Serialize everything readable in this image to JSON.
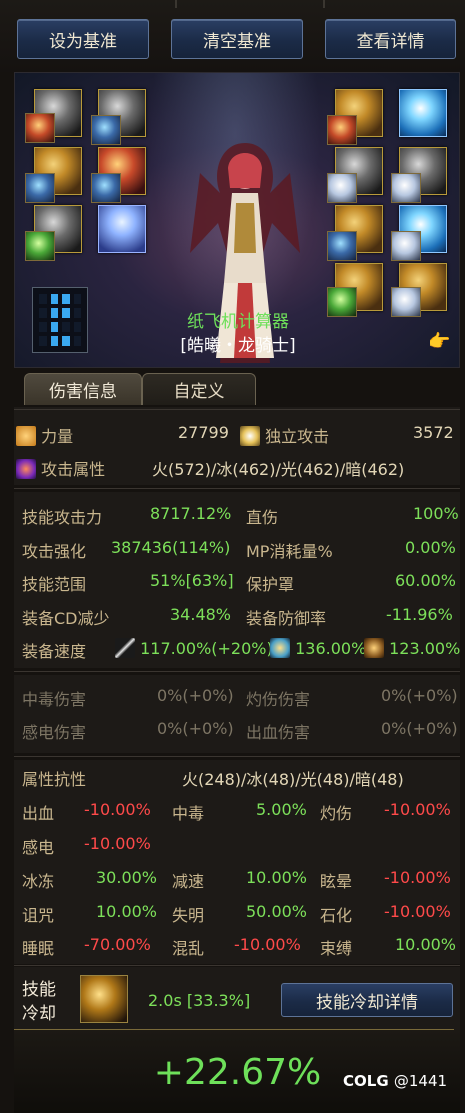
{
  "top_buttons": [
    {
      "label": "设为基准"
    },
    {
      "label": "清空基准"
    },
    {
      "label": "查看详情"
    }
  ],
  "avatar": {
    "calculator_name": "纸飞机计算器",
    "character_title": "[皓曦・龙骑士]",
    "hand_icon": "pointing-hand-icon"
  },
  "tabs": [
    {
      "label": "伤害信息",
      "active": true
    },
    {
      "label": "自定义",
      "active": false
    }
  ],
  "main_stats": {
    "strength_label": "力量",
    "strength_value": "27799",
    "independent_attack_label": "独立攻击",
    "independent_attack_value": "3572",
    "element_label": "攻击属性",
    "element_value": "火(572)/冰(462)/光(462)/暗(462)"
  },
  "skill_stats": {
    "skill_attack_label": "技能攻击力",
    "skill_attack_value": "8717.12%",
    "direct_label": "直伤",
    "direct_value": "100%",
    "attack_enhance_label": "攻击强化",
    "attack_enhance_value": "387436(114%)",
    "mp_cost_label": "MP消耗量%",
    "mp_cost_value": "0.00%",
    "skill_range_label": "技能范围",
    "skill_range_value": "51%[63%]",
    "shield_label": "保护罩",
    "shield_value": "60.00%",
    "cd_reduce_label": "装备CD减少",
    "cd_reduce_value": "34.48%",
    "equip_defense_label": "装备防御率",
    "equip_defense_value": "-11.96%",
    "equip_speed_label": "装备速度",
    "speed_attack_value": "117.00%(+20%)",
    "speed_cast_value": "136.00%",
    "speed_move_value": "123.00%"
  },
  "status_damage": {
    "poison_label": "中毒伤害",
    "poison_value": "0%(+0%)",
    "burn_label": "灼伤伤害",
    "burn_value": "0%(+0%)",
    "shock_label": "感电伤害",
    "shock_value": "0%(+0%)",
    "bleed_label": "出血伤害",
    "bleed_value": "0%(+0%)"
  },
  "resist": {
    "title_label": "属性抗性",
    "title_value": "火(248)/冰(48)/光(48)/暗(48)",
    "items": [
      {
        "label": "出血",
        "value": "-10.00%",
        "neg": true
      },
      {
        "label": "中毒",
        "value": "5.00%",
        "neg": false
      },
      {
        "label": "灼伤",
        "value": "-10.00%",
        "neg": true
      },
      {
        "label": "感电",
        "value": "-10.00%",
        "neg": true
      },
      {
        "label": "冰冻",
        "value": "30.00%",
        "neg": false
      },
      {
        "label": "减速",
        "value": "10.00%",
        "neg": false
      },
      {
        "label": "眩晕",
        "value": "-10.00%",
        "neg": true
      },
      {
        "label": "诅咒",
        "value": "10.00%",
        "neg": false
      },
      {
        "label": "失明",
        "value": "50.00%",
        "neg": false
      },
      {
        "label": "石化",
        "value": "-10.00%",
        "neg": true
      },
      {
        "label": "睡眠",
        "value": "-70.00%",
        "neg": true
      },
      {
        "label": "混乱",
        "value": "-10.00%",
        "neg": true
      },
      {
        "label": "束缚",
        "value": "10.00%",
        "neg": false
      }
    ]
  },
  "cooldown": {
    "label_line1": "技能",
    "label_line2": "冷却",
    "value": "2.0s [33.3%]",
    "detail_button": "技能冷却详情"
  },
  "result": {
    "percent": "+22.67%"
  },
  "footer": {
    "brand": "COLG",
    "handle": "@1441"
  },
  "colors": {
    "positive": "#7de05a",
    "negative": "#ff4a4a",
    "label": "#c9b68e",
    "button_bg": "#1b2b47"
  }
}
